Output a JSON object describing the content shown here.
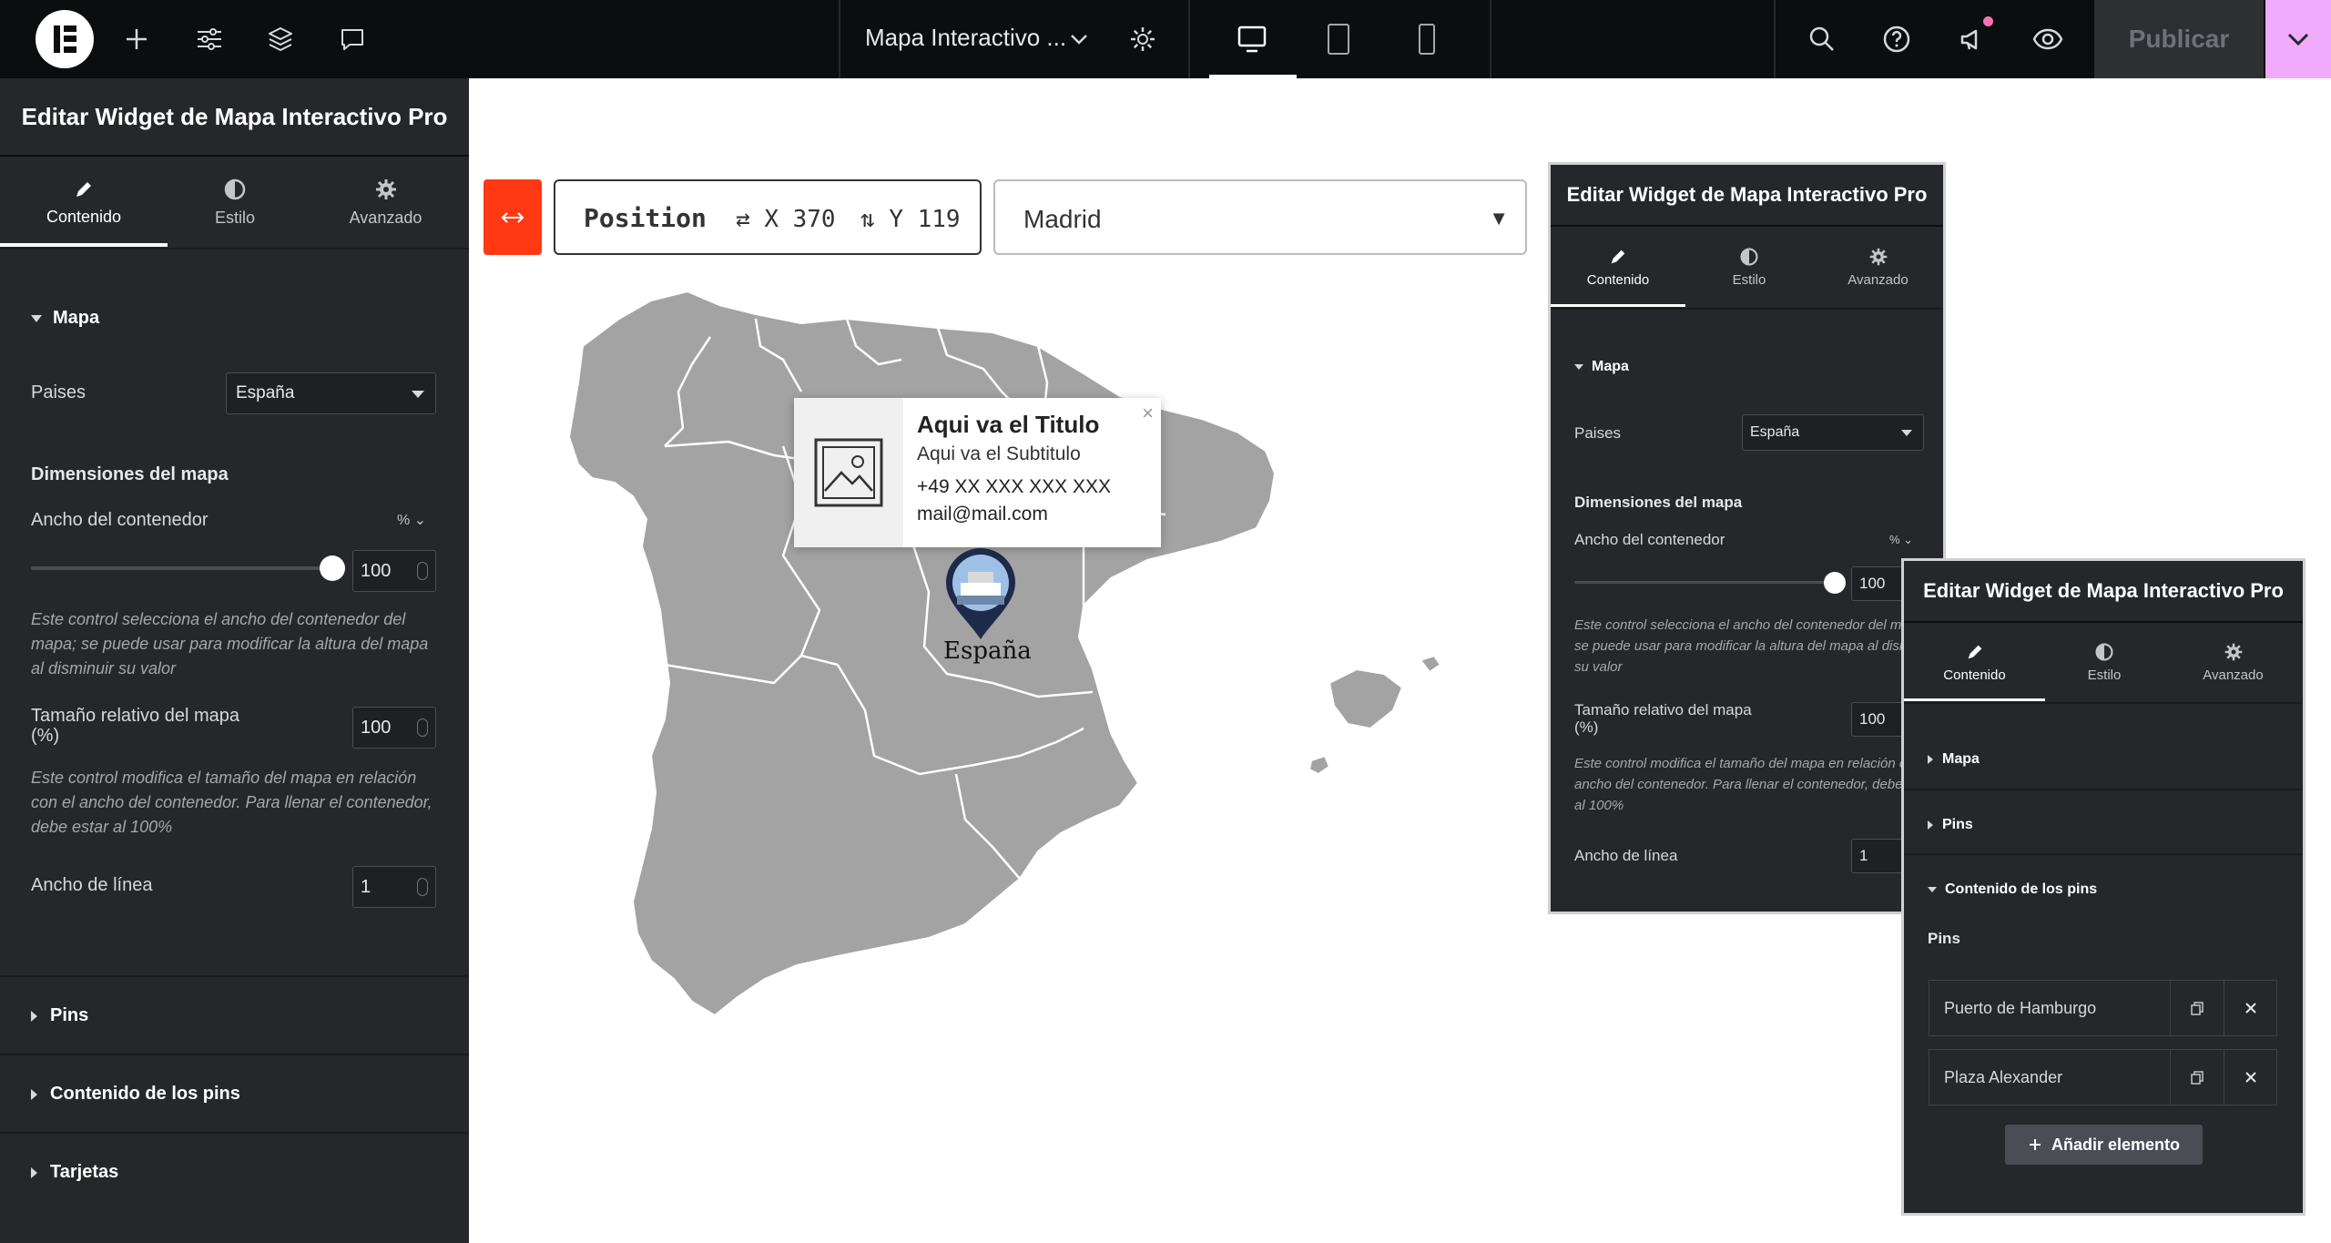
{
  "topbar": {
    "document_title": "Mapa Interactivo ...",
    "publish_label": "Publicar"
  },
  "panel": {
    "title": "Editar Widget de Mapa Interactivo Pro",
    "tabs": [
      "Contenido",
      "Estilo",
      "Avanzado"
    ],
    "sections": {
      "map": "Mapa",
      "pins": "Pins",
      "pins_content": "Contenido de los pins",
      "cards": "Tarjetas"
    },
    "countries_label": "Paises",
    "countries_value": "España",
    "dimensions_title": "Dimensiones del mapa",
    "container_width_label": "Ancho del contenedor",
    "container_width_unit": "%",
    "container_width_value": "100",
    "container_width_help": "Este control selecciona el ancho del contenedor del mapa; se puede usar para modificar la altura del mapa al disminuir su valor",
    "relative_size_label": "Tamaño relativo del mapa (%)",
    "relative_size_value": "100",
    "relative_size_help": "Este control modifica el tamaño del mapa en relación con el ancho del contenedor. Para llenar el contenedor, debe estar al 100%",
    "line_width_label": "Ancho de línea",
    "line_width_value": "1",
    "pins_list_label": "Pins",
    "pins_items": [
      "Puerto de Hamburgo",
      "Plaza Alexander"
    ],
    "add_item_label": "Añadir elemento"
  },
  "canvas": {
    "position_label": "Position",
    "x_label": "X 370",
    "y_label": "Y 119",
    "city_selected": "Madrid",
    "tooltip": {
      "title": "Aqui va el Titulo",
      "subtitle": "Aqui va el Subtitulo",
      "phone": "+49 XX XXX XXX XXX",
      "email": "mail@mail.com"
    },
    "pin_label": "España"
  },
  "colors": {
    "accent_red": "#ff3a13",
    "publish_arrow_bg": "#f0abfc",
    "panel_bg": "#26272b",
    "map_fill": "#a3a3a3"
  }
}
